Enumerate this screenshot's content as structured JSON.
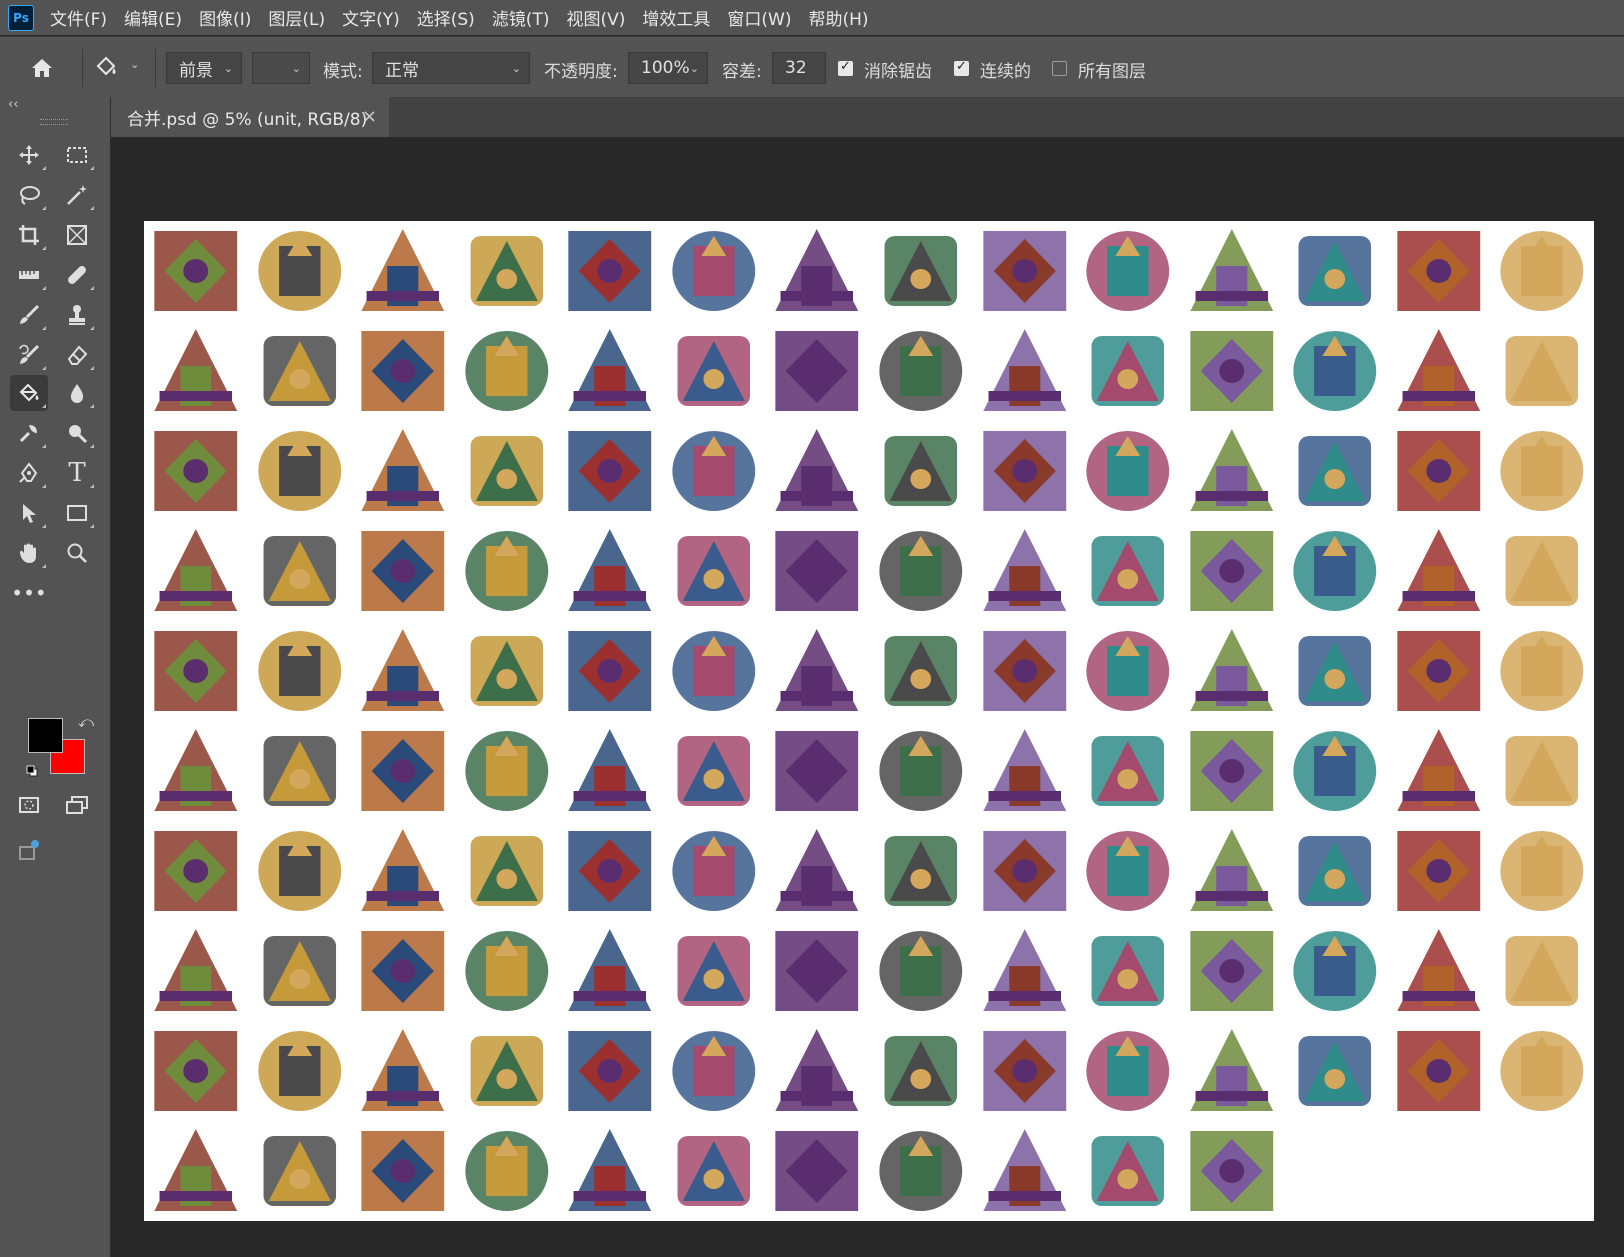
{
  "app": {
    "logo": "Ps"
  },
  "menu": [
    "文件(F)",
    "编辑(E)",
    "图像(I)",
    "图层(L)",
    "文字(Y)",
    "选择(S)",
    "滤镜(T)",
    "视图(V)",
    "增效工具",
    "窗口(W)",
    "帮助(H)"
  ],
  "options": {
    "source_value": "前景",
    "mode_label": "模式:",
    "mode_value": "正常",
    "opacity_label": "不透明度:",
    "opacity_value": "100%",
    "tolerance_label": "容差:",
    "tolerance_value": "32",
    "antialias_label": "消除锯齿",
    "antialias_checked": true,
    "contiguous_label": "连续的",
    "contiguous_checked": true,
    "all_layers_label": "所有图层",
    "all_layers_checked": false
  },
  "toolbar": {
    "collapse_glyph": "‹‹",
    "tools": [
      "move-icon",
      "marquee-icon",
      "lasso-icon",
      "magic-wand-icon",
      "crop-icon",
      "frame-icon",
      "ruler-icon",
      "healing-brush-icon",
      "brush-icon",
      "clone-stamp-icon",
      "history-brush-icon",
      "eraser-icon",
      "paint-bucket-icon",
      "blur-icon",
      "dodge-icon",
      "burn-icon",
      "pen-icon",
      "type-icon",
      "path-selection-icon",
      "rectangle-icon",
      "hand-icon",
      "zoom-icon",
      "more-tools-icon"
    ],
    "foreground_color": "#000000",
    "background_color": "#ff0000"
  },
  "document": {
    "tab_title": "合并.psd @ 5% (unit, RGB/8)",
    "icon_count": 137,
    "palette": [
      "#8a3a2a",
      "#3a5c8c",
      "#6f8b3c",
      "#c49a3a",
      "#5a2e6e",
      "#2f8c8a",
      "#b0622a",
      "#4a4a4a",
      "#9c2f2f",
      "#3c6f4a",
      "#7a5a9c",
      "#d4a85c",
      "#2a4a7a",
      "#a44a6c"
    ]
  }
}
